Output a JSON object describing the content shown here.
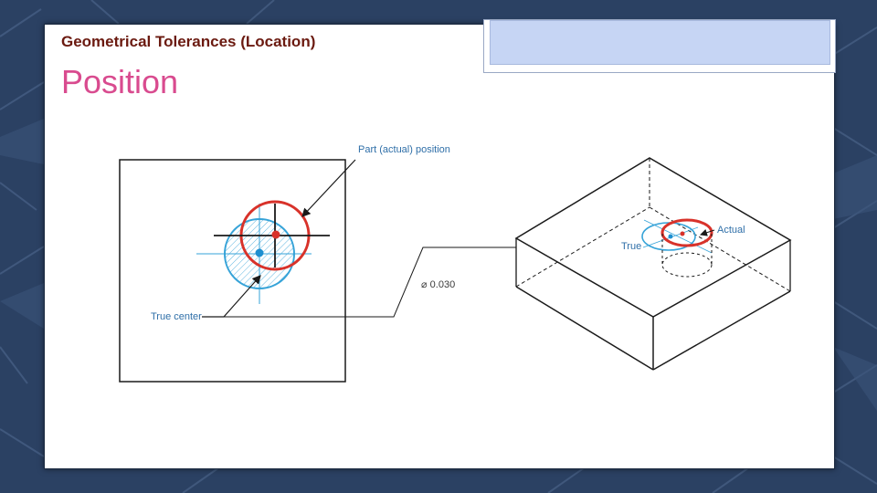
{
  "slide": {
    "subtitle": "Geometrical Tolerances (Location)",
    "title": "Position"
  },
  "figure": {
    "labels": {
      "part_position": "Part (actual) position",
      "true_center": "True center",
      "tolerance": "⌀ 0.030",
      "true": "True",
      "actual": "Actual"
    },
    "colors": {
      "true_circle": "#36a3d8",
      "actual_circle": "#d8322a",
      "lines": "#1a1a1a",
      "slide_bg": "#2b4163"
    }
  }
}
